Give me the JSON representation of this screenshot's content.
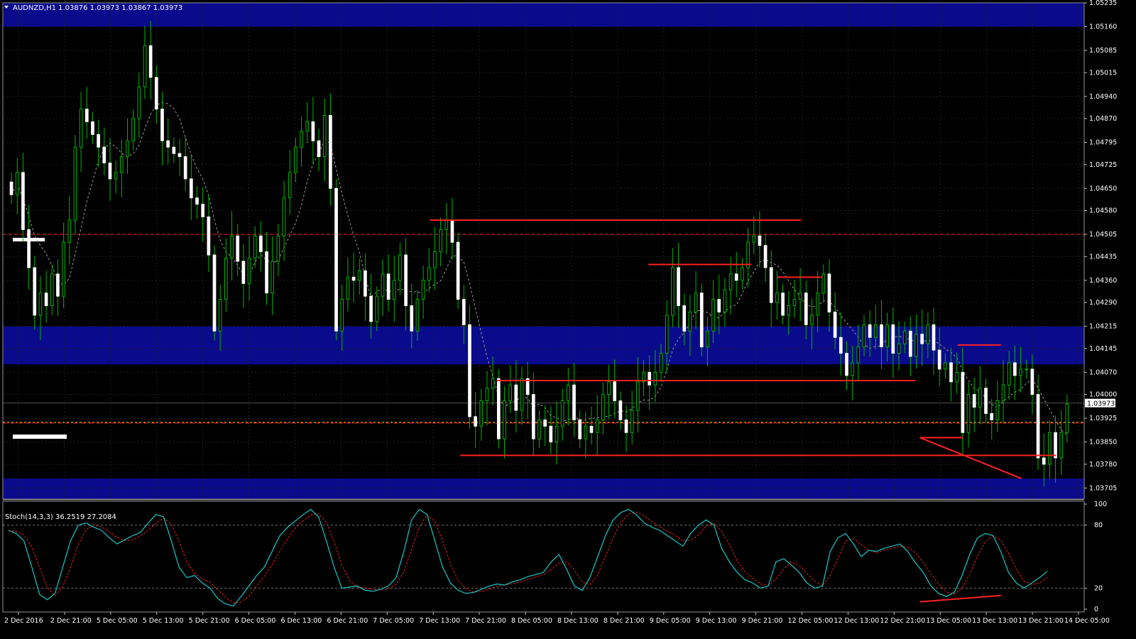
{
  "symbol_header": "AUDNZD,H1  1.03876 1.03973 1.03867 1.03973",
  "stoch_header": "Stoch(14,3,3) 36.2519 27.2084",
  "colors": {
    "background": "#000000",
    "zone": "#0a0a8c",
    "candle_body": "#ffffff",
    "wick": "#00b400",
    "red_lines": "#ff2020",
    "ma_line": "#9a9a9a",
    "stoch_main": "#18c8c8",
    "stoch_signal": "#e02020",
    "grid": "#202020"
  },
  "chart_data": {
    "type": "candlestick",
    "symbol": "AUDNZD",
    "timeframe": "H1",
    "ylim": [
      1.0367,
      1.05235
    ],
    "y_ticks": [
      "1.05235",
      "1.05160",
      "1.05085",
      "1.05015",
      "1.04940",
      "1.04870",
      "1.04795",
      "1.04725",
      "1.04650",
      "1.04580",
      "1.04505",
      "1.04435",
      "1.04360",
      "1.04290",
      "1.04215",
      "1.04145",
      "1.04070",
      "1.04000",
      "1.03925",
      "1.03850",
      "1.03780",
      "1.03705"
    ],
    "current_price": "1.03973",
    "x_labels": [
      "2 Dec 2016",
      "2 Dec 21:00",
      "5 Dec 05:00",
      "5 Dec 13:00",
      "5 Dec 21:00",
      "6 Dec 05:00",
      "6 Dec 13:00",
      "6 Dec 21:00",
      "7 Dec 05:00",
      "7 Dec 13:00",
      "7 Dec 21:00",
      "8 Dec 05:00",
      "8 Dec 13:00",
      "8 Dec 21:00",
      "9 Dec 05:00",
      "9 Dec 13:00",
      "9 Dec 21:00",
      "12 Dec 05:00",
      "12 Dec 13:00",
      "12 Dec 21:00",
      "13 Dec 05:00",
      "13 Dec 13:00",
      "13 Dec 21:00",
      "14 Dec 05:00"
    ],
    "closes": [
      1.0463,
      1.047,
      1.0452,
      1.044,
      1.0425,
      1.0432,
      1.0428,
      1.0438,
      1.0431,
      1.0448,
      1.0455,
      1.0478,
      1.049,
      1.0486,
      1.0482,
      1.0478,
      1.0473,
      1.0468,
      1.047,
      1.0475,
      1.048,
      1.0487,
      1.0497,
      1.051,
      1.05,
      1.049,
      1.048,
      1.0478,
      1.0476,
      1.0475,
      1.0468,
      1.0462,
      1.046,
      1.0456,
      1.0444,
      1.042,
      1.043,
      1.0443,
      1.045,
      1.0442,
      1.0435,
      1.0443,
      1.045,
      1.0445,
      1.0432,
      1.0442,
      1.045,
      1.0462,
      1.047,
      1.0478,
      1.0483,
      1.0486,
      1.048,
      1.0475,
      1.0488,
      1.0465,
      1.042,
      1.043,
      1.0437,
      1.0436,
      1.0439,
      1.0431,
      1.0423,
      1.0431,
      1.0438,
      1.043,
      1.0436,
      1.0444,
      1.0428,
      1.042,
      1.043,
      1.0436,
      1.044,
      1.0445,
      1.0452,
      1.0455,
      1.0448,
      1.043,
      1.0422,
      1.0393,
      1.039,
      1.0398,
      1.0402,
      1.0405,
      1.0386,
      1.0398,
      1.0403,
      1.0395,
      1.0405,
      1.04,
      1.0386,
      1.0392,
      1.039,
      1.0385,
      1.039,
      1.0398,
      1.0403,
      1.0392,
      1.0386,
      1.039,
      1.0388,
      1.0392,
      1.04,
      1.0404,
      1.0398,
      1.0392,
      1.0388,
      1.0395,
      1.0404,
      1.0407,
      1.0403,
      1.0407,
      1.0413,
      1.0425,
      1.044,
      1.0428,
      1.042,
      1.0426,
      1.0432,
      1.0415,
      1.042,
      1.043,
      1.0426,
      1.0433,
      1.0438,
      1.0436,
      1.044,
      1.0448,
      1.045,
      1.0447,
      1.044,
      1.0429,
      1.0432,
      1.0425,
      1.0428,
      1.043,
      1.0432,
      1.0422,
      1.0425,
      1.0432,
      1.0438,
      1.0426,
      1.0418,
      1.0413,
      1.0406,
      1.041,
      1.0415,
      1.0422,
      1.0418,
      1.0422,
      1.0415,
      1.0422,
      1.0413,
      1.0416,
      1.042,
      1.0412,
      1.0419,
      1.0416,
      1.0422,
      1.0414,
      1.0408,
      1.041,
      1.0404,
      1.0407,
      1.0388,
      1.04,
      1.0396,
      1.0402,
      1.0394,
      1.0392,
      1.0398,
      1.0403,
      1.041,
      1.0406,
      1.0408,
      1.0408,
      1.04,
      1.038,
      1.0378,
      1.0388,
      1.038,
      1.0388,
      1.0397
    ],
    "horizontal_levels": [
      1.04505,
      1.03912
    ],
    "support_resistance_zones": [
      [
        1.0516,
        1.05235
      ],
      [
        1.04095,
        1.04215
      ],
      [
        1.0367,
        1.03735
      ]
    ],
    "stochastic": {
      "k": 14,
      "d": 3,
      "slowing": 3,
      "main": 36.2519,
      "signal": 27.2084,
      "levels": [
        80,
        20
      ],
      "y_ticks": [
        "100",
        "80",
        "20",
        "0"
      ],
      "main_values": [
        75,
        72,
        65,
        40,
        14,
        9,
        15,
        40,
        65,
        80,
        82,
        78,
        75,
        68,
        62,
        66,
        70,
        73,
        82,
        90,
        88,
        65,
        40,
        30,
        32,
        25,
        20,
        10,
        5,
        3,
        12,
        22,
        32,
        40,
        55,
        70,
        78,
        84,
        90,
        95,
        88,
        65,
        40,
        20,
        21,
        22,
        18,
        17,
        19,
        22,
        30,
        55,
        85,
        95,
        90,
        65,
        40,
        25,
        18,
        15,
        16,
        19,
        22,
        24,
        23,
        26,
        28,
        31,
        33,
        35,
        45,
        52,
        38,
        22,
        18,
        30,
        50,
        70,
        85,
        92,
        95,
        90,
        82,
        78,
        75,
        70,
        65,
        60,
        72,
        80,
        85,
        80,
        58,
        45,
        35,
        28,
        25,
        20,
        22,
        45,
        48,
        42,
        35,
        25,
        20,
        22,
        55,
        68,
        72,
        62,
        50,
        56,
        55,
        58,
        60,
        62,
        55,
        44,
        35,
        22,
        15,
        12,
        16,
        32,
        52,
        68,
        72,
        70,
        55,
        35,
        25,
        20,
        25,
        30,
        36
      ]
    },
    "trendlines": [
      {
        "from": [
          0.395,
          1.0455
        ],
        "to": [
          0.738,
          1.0455
        ]
      },
      {
        "from": [
          0.597,
          1.0441
        ],
        "to": [
          0.692,
          1.0441
        ]
      },
      {
        "from": [
          0.716,
          1.0437
        ],
        "to": [
          0.758,
          1.0437
        ]
      },
      {
        "from": [
          0.457,
          1.04044
        ],
        "to": [
          0.844,
          1.04044
        ]
      },
      {
        "from": [
          0.423,
          1.03808
        ],
        "to": [
          0.974,
          1.03808
        ]
      },
      {
        "from": [
          0.848,
          1.03864
        ],
        "to": [
          0.888,
          1.03864
        ]
      },
      {
        "from": [
          0.883,
          1.04156
        ],
        "to": [
          0.923,
          1.04156
        ]
      },
      {
        "from": [
          0.848,
          1.03864
        ],
        "to": [
          0.942,
          1.03735
        ]
      }
    ]
  }
}
